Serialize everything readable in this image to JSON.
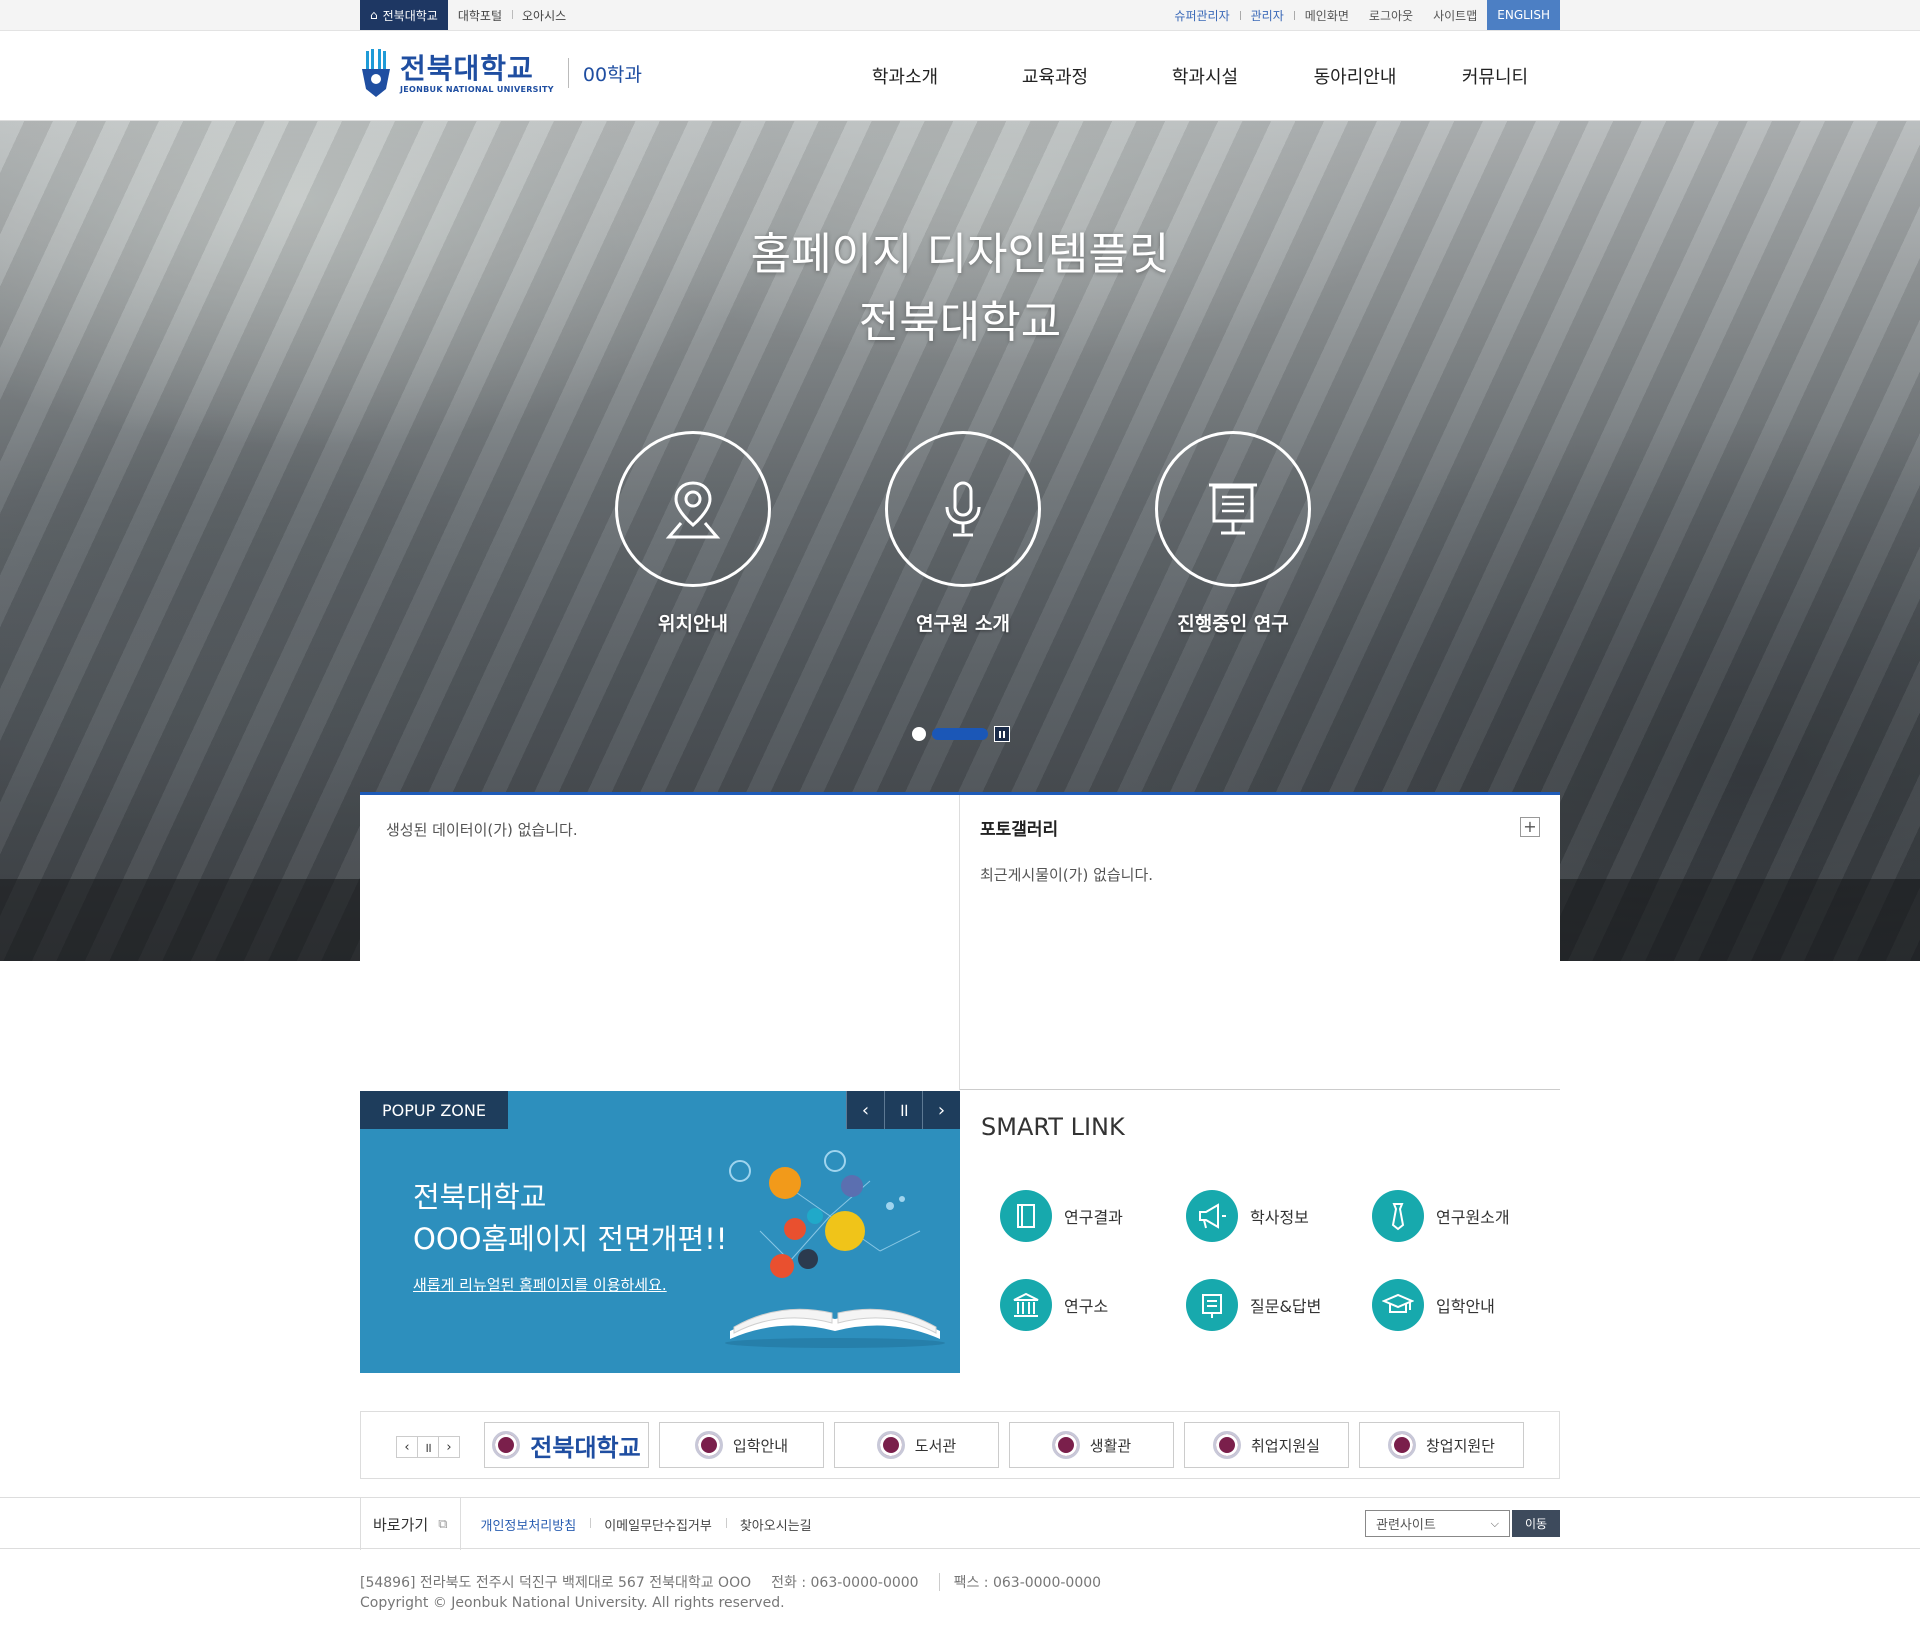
{
  "util": {
    "home": "전북대학교",
    "left_links": [
      "대학포털",
      "오아시스"
    ],
    "super_admin": "슈퍼관리자",
    "admin": "관리자",
    "main": "메인화면",
    "logout": "로그아웃",
    "sitemap": "사이트맵",
    "english": "ENGLISH"
  },
  "header": {
    "logo_kor": "전북대학교",
    "logo_eng": "JEONBUK NATIONAL UNIVERSITY",
    "dept": "00학과",
    "nav": [
      "학과소개",
      "교육과정",
      "학과시설",
      "동아리안내",
      "커뮤니티"
    ]
  },
  "hero": {
    "title_line1": "홈페이지 디자인템플릿",
    "title_line2": "전북대학교",
    "quick": [
      {
        "label": "위치안내",
        "icon": "location-pin-icon"
      },
      {
        "label": "연구원 소개",
        "icon": "microphone-icon"
      },
      {
        "label": "진행중인 연구",
        "icon": "presentation-board-icon"
      }
    ]
  },
  "boxes": {
    "left_empty": "생성된 데이터이(가) 없습니다.",
    "gallery_title": "포토갤러리",
    "gallery_empty": "최근게시물이(가) 없습니다."
  },
  "popup": {
    "tag": "POPUP ZONE",
    "headline1": "전북대학교",
    "headline2": "OOO홈페이지 전면개편!!",
    "sub": "새롭게 리뉴얼된 홈페이지를 이용하세요."
  },
  "smart": {
    "title": "SMART LINK",
    "items": [
      {
        "label": "연구결과",
        "icon": "book-icon"
      },
      {
        "label": "학사정보",
        "icon": "megaphone-icon"
      },
      {
        "label": "연구원소개",
        "icon": "tie-icon"
      },
      {
        "label": "연구소",
        "icon": "building-icon"
      },
      {
        "label": "질문&답변",
        "icon": "board-icon"
      },
      {
        "label": "입학안내",
        "icon": "graduation-cap-icon"
      }
    ]
  },
  "banners": {
    "main": "전북대학교",
    "items": [
      "입학안내",
      "도서관",
      "생활관",
      "취업지원실",
      "창업지원단"
    ]
  },
  "footer": {
    "shortcut": "바로가기",
    "links": [
      "개인정보처리방침",
      "이메일무단수집거부",
      "찾아오시는길"
    ],
    "related": "관련사이트",
    "go": "이동",
    "address": "[54896] 전라북도 전주시 덕진구 백제대로 567 전북대학교 OOO",
    "phone": "전화 : 063-0000-0000",
    "fax": "팩스 : 063-0000-0000",
    "copyright": "Copyright © Jeonbuk National University. All rights reserved."
  }
}
